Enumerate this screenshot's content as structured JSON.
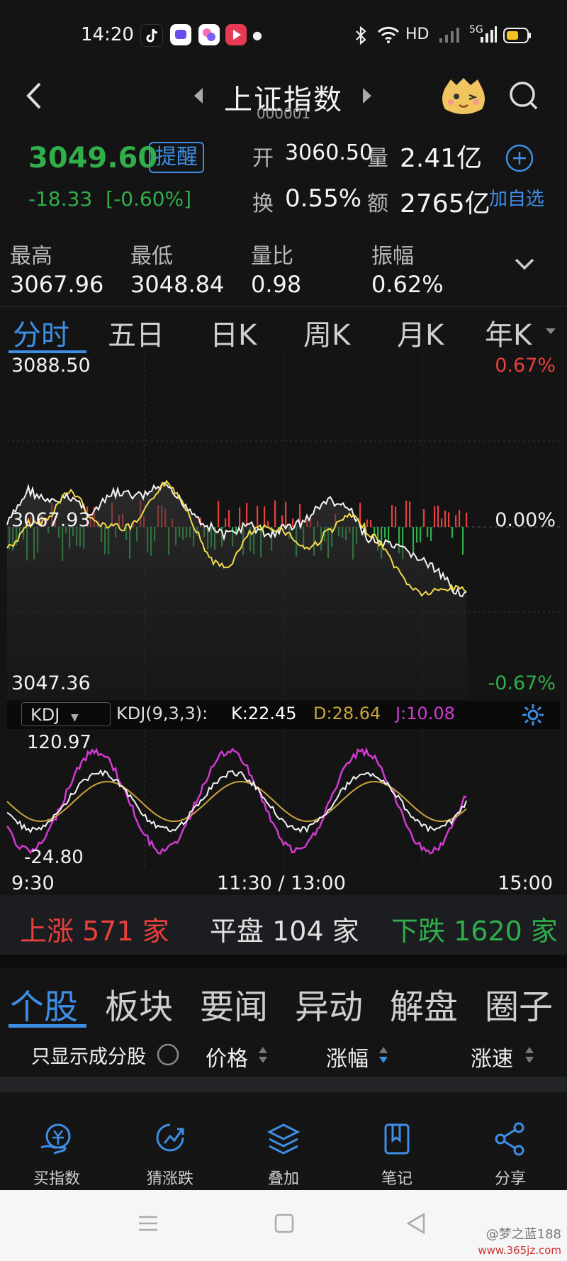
{
  "status_bar": {
    "time": "14:20",
    "network_label": "HD",
    "signal_label": "5G"
  },
  "header": {
    "title": "上证指数",
    "code": "000001"
  },
  "quote": {
    "price": "3049.60",
    "alert_label": "提醒",
    "change": "-18.33",
    "change_pct": "[-0.60%]",
    "open_label": "开",
    "open_value": "3060.50",
    "volume_label": "量",
    "volume_value": "2.41亿",
    "turnover_label": "换",
    "turnover_value": "0.55%",
    "amount_label": "额",
    "amount_value": "2765亿",
    "add_watch_label": "加自选"
  },
  "stats": [
    {
      "label": "最高",
      "value": "3067.96"
    },
    {
      "label": "最低",
      "value": "3048.84"
    },
    {
      "label": "量比",
      "value": "0.98"
    },
    {
      "label": "振幅",
      "value": "0.62%"
    }
  ],
  "chart_tabs": [
    "分时",
    "五日",
    "日K",
    "周K",
    "月K",
    "年K"
  ],
  "chart_tabs_active": 0,
  "intraday": {
    "y_max": "3088.50",
    "y_mid": "3067.93",
    "y_min": "3047.36",
    "pct_max": "0.67%",
    "pct_mid": "0.00%",
    "pct_min": "-0.67%"
  },
  "kdj": {
    "indicator": "KDJ",
    "params": "KDJ(9,3,3):",
    "k": "K:22.45",
    "d": "D:28.64",
    "j": "J:10.08",
    "y_max": "120.97",
    "y_min": "-24.80"
  },
  "time_axis": {
    "start": "9:30",
    "mid": "11:30 / 13:00",
    "end": "15:00"
  },
  "breadth": {
    "up_label": "上涨",
    "up_count": "571",
    "up_unit": "家",
    "flat_label": "平盘",
    "flat_count": "104",
    "flat_unit": "家",
    "down_label": "下跌",
    "down_count": "1620",
    "down_unit": "家"
  },
  "section_tabs": [
    "个股",
    "板块",
    "要闻",
    "异动",
    "解盘",
    "圈子"
  ],
  "list_header": {
    "filter_label": "只显示成分股",
    "price": "价格",
    "change_pct": "涨幅",
    "speed": "涨速"
  },
  "toolbar": [
    {
      "label": "买指数",
      "icon": "buy-index-icon"
    },
    {
      "label": "猜涨跌",
      "icon": "guess-icon"
    },
    {
      "label": "叠加",
      "icon": "layers-icon"
    },
    {
      "label": "笔记",
      "icon": "note-icon"
    },
    {
      "label": "分享",
      "icon": "share-icon"
    }
  ],
  "watermark": {
    "line1": "@梦之蓝188",
    "line2": "www.365jz.com"
  },
  "colors": {
    "up": "#e8403a",
    "down": "#2fae4a",
    "accent": "#3d8fe6",
    "j_line": "#d23ad2",
    "d_line": "#c9a53a"
  }
}
